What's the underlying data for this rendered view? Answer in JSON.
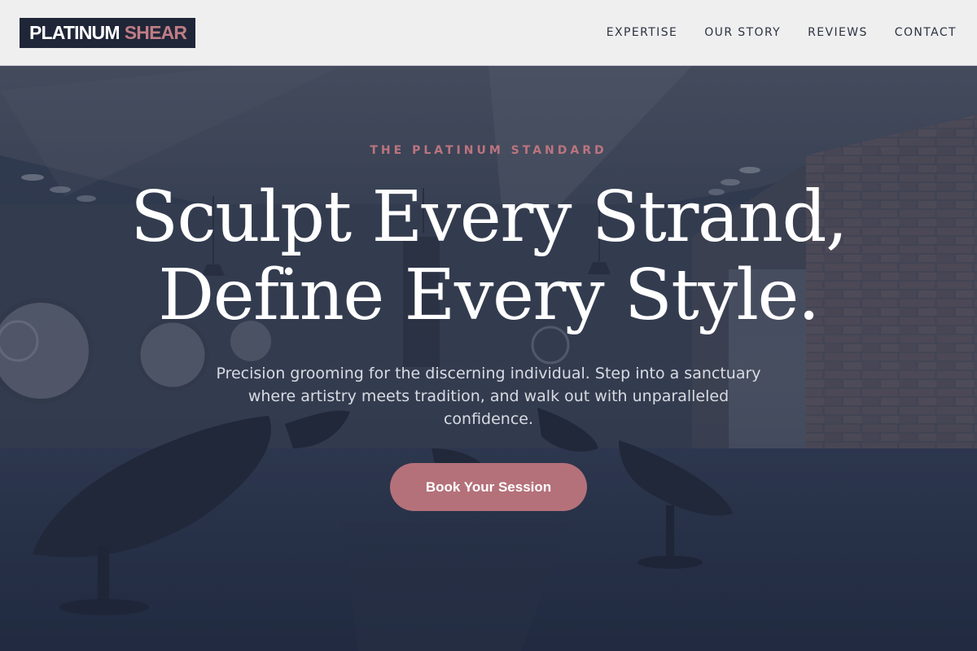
{
  "brand": {
    "name_main": "PLATINUM",
    "name_accent": "SHEAR"
  },
  "nav": {
    "items": [
      {
        "label": "EXPERTISE"
      },
      {
        "label": "OUR STORY"
      },
      {
        "label": "REVIEWS"
      },
      {
        "label": "CONTACT"
      }
    ]
  },
  "hero": {
    "eyebrow": "THE PLATINUM STANDARD",
    "headline_line1": "Sculpt Every Strand,",
    "headline_line2": "Define Every Style.",
    "subtext": "Precision grooming for the discerning individual. Step into a sanctuary where artistry meets tradition, and walk out with unparalleled confidence.",
    "cta_label": "Book Your Session"
  },
  "colors": {
    "brand_dark": "#1f2638",
    "accent_rose": "#b4717a",
    "header_bg": "#efeff0",
    "hero_overlay": "#28334b"
  }
}
